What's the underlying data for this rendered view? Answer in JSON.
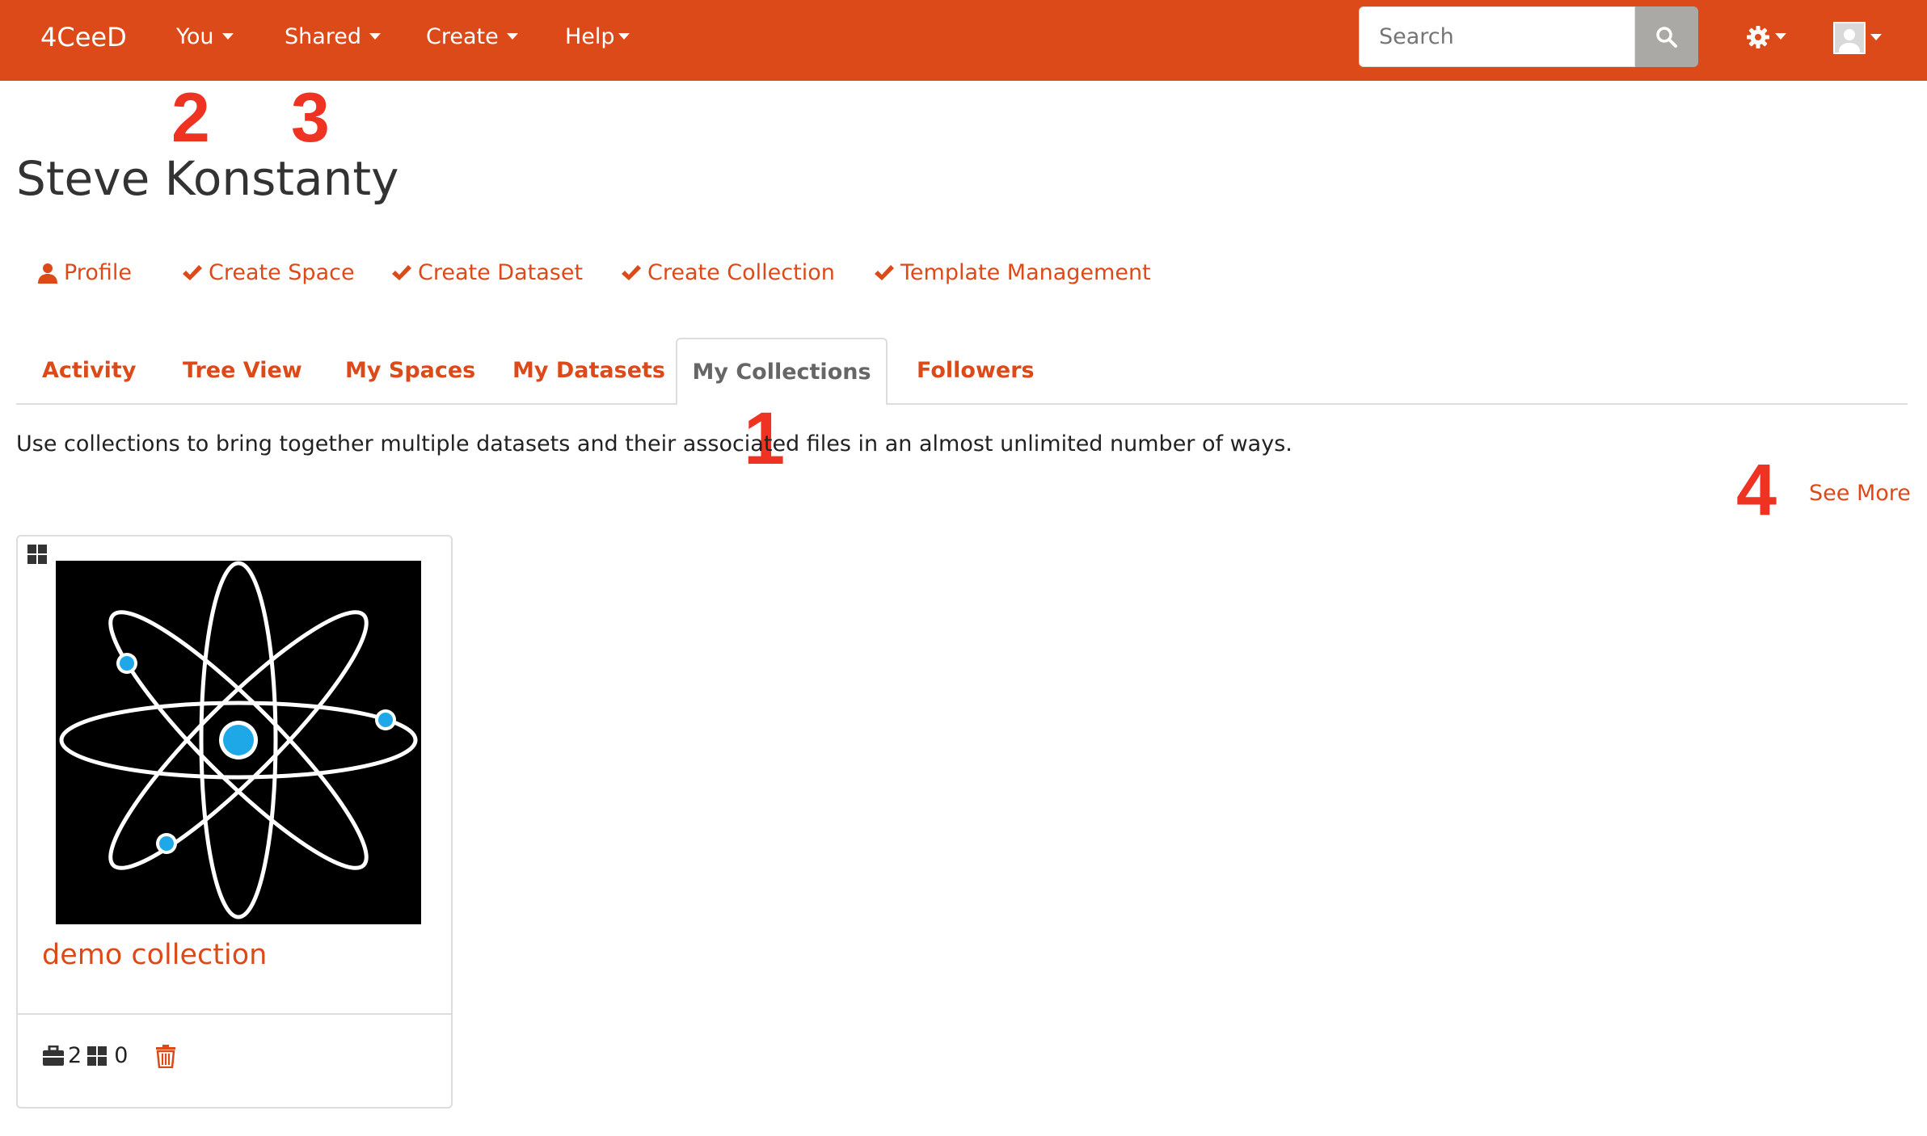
{
  "navbar": {
    "brand": "4CeeD",
    "menu": [
      {
        "label": "You"
      },
      {
        "label": "Shared"
      },
      {
        "label": "Create"
      },
      {
        "label": "Help"
      }
    ],
    "search_placeholder": "Search",
    "colors": {
      "bar": "#dd4a1a",
      "search_button": "#aaa9a6"
    }
  },
  "annotations": [
    "2",
    "3",
    "1",
    "4"
  ],
  "page": {
    "title": "Steve Konstanty",
    "actions": [
      {
        "label": "Profile",
        "icon": "user-icon"
      },
      {
        "label": "Create Space",
        "icon": "check-icon"
      },
      {
        "label": "Create Dataset",
        "icon": "check-icon"
      },
      {
        "label": "Create Collection",
        "icon": "check-icon"
      },
      {
        "label": "Template Management",
        "icon": "check-icon"
      }
    ],
    "tabs": [
      {
        "label": "Activity",
        "active": false
      },
      {
        "label": "Tree View",
        "active": false
      },
      {
        "label": "My Spaces",
        "active": false
      },
      {
        "label": "My Datasets",
        "active": false
      },
      {
        "label": "My Collections",
        "active": true
      },
      {
        "label": "Followers",
        "active": false
      }
    ],
    "description": "Use collections to bring together multiple datasets and their associated files in an almost unlimited number of ways.",
    "see_more": "See More"
  },
  "collection_card": {
    "title": "demo collection",
    "thumbnail": "atom-image",
    "datasets_count": "2",
    "child_collections_count": "0",
    "icons": [
      "grid-icon",
      "briefcase-icon",
      "trash-icon"
    ]
  }
}
